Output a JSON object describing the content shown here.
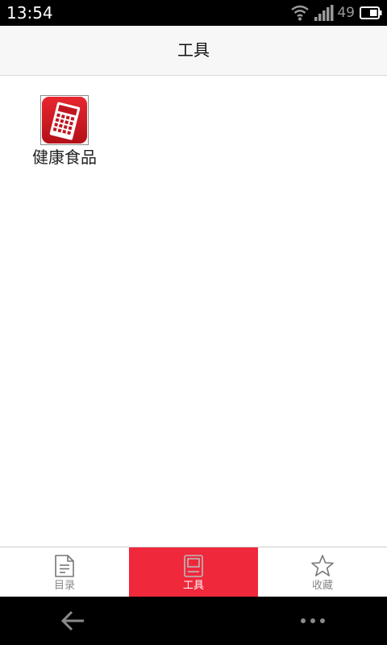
{
  "status_bar": {
    "time": "13:54",
    "battery_level": "49",
    "icons": [
      "wifi-icon",
      "signal-icon",
      "battery-icon"
    ]
  },
  "header": {
    "title": "工具"
  },
  "tools": [
    {
      "label": "健康食品",
      "icon": "calculator-icon"
    }
  ],
  "tabs": [
    {
      "label": "目录",
      "icon": "document-icon",
      "active": false
    },
    {
      "label": "工具",
      "icon": "tool-book-icon",
      "active": true
    },
    {
      "label": "收藏",
      "icon": "star-icon",
      "active": false
    }
  ],
  "nav_bar": {
    "icons": [
      "back-arrow-icon",
      "more-dots-icon"
    ]
  },
  "colors": {
    "accent": "#f0283c",
    "status_bar_bg": "#000000",
    "title_bar_bg": "#f7f7f7",
    "tab_inactive_text": "#888888"
  }
}
